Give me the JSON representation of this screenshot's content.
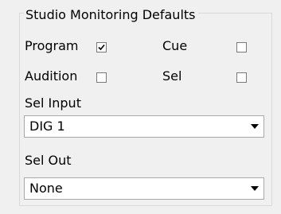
{
  "group": {
    "title": "Studio Monitoring Defaults"
  },
  "checkboxes": {
    "program": {
      "label": "Program",
      "checked": true
    },
    "cue": {
      "label": "Cue",
      "checked": false
    },
    "audition": {
      "label": "Audition",
      "checked": false
    },
    "sel": {
      "label": "Sel",
      "checked": false
    }
  },
  "sel_input": {
    "label": "Sel Input",
    "value": "DIG 1"
  },
  "sel_out": {
    "label": "Sel Out",
    "value": "None"
  },
  "icons": {
    "checkmark": "checkmark-icon",
    "dropdown": "chevron-down-icon"
  }
}
